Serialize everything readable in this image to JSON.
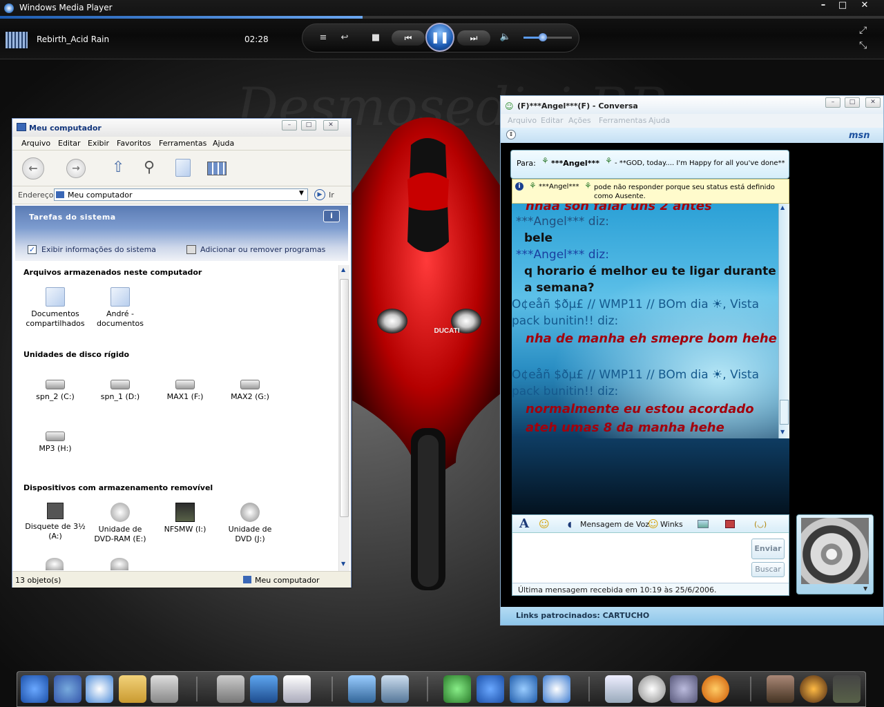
{
  "wmp": {
    "title": "Windows Media Player",
    "track": "Rebirth_Acid Rain",
    "time": "02:28",
    "progress_fraction": 0.41,
    "volume_fraction": 0.38
  },
  "wallpaper": {
    "watermark": "Desmosedici RR"
  },
  "explorer": {
    "title": "Meu computador",
    "menu": [
      "Arquivo",
      "Editar",
      "Exibir",
      "Favoritos",
      "Ferramentas",
      "Ajuda"
    ],
    "address_label": "Endereço",
    "address_value": "Meu computador",
    "go_label": "Ir",
    "tasks_header": "Tarefas do sistema",
    "task_links": [
      "Exibir informações do sistema",
      "Adicionar ou remover programas"
    ],
    "groups": [
      {
        "title": "Arquivos armazenados neste computador",
        "items": [
          "Documentos compartilhados",
          "André - documentos"
        ]
      },
      {
        "title": "Unidades de disco rígido",
        "items": [
          "spn_2 (C:)",
          "spn_1 (D:)",
          "MAX1 (F:)",
          "MAX2 (G:)",
          "MP3 (H:)"
        ]
      },
      {
        "title": "Dispositivos com armazenamento removível",
        "items": [
          "Disquete de 3½ (A:)",
          "Unidade de DVD-RAM (E:)",
          "NFSMW (I:)",
          "Unidade de DVD (J:)"
        ]
      }
    ],
    "status_count": "13 objeto(s)",
    "status_location": "Meu computador"
  },
  "msn": {
    "title": "(F)***Angel***(F) - Conversa",
    "menu": [
      "Arquivo",
      "Editar",
      "Ações",
      "Ferramentas",
      "Ajuda"
    ],
    "brand": "msn",
    "to_label": "Para:",
    "to_name": "***Angel***",
    "to_message": "- **GOD, today.... I'm Happy for all you've done**",
    "warning_name": "***Angel***",
    "warning_text": "pode não responder porque seu status está definido como Ausente.",
    "messages": [
      {
        "sender": "",
        "text": "nhaa son falar uns 2 antes"
      },
      {
        "sender": "***Angel*** diz:",
        "text": "bele"
      },
      {
        "sender": "***Angel*** diz:",
        "text": "q horario é melhor eu te ligar durante a semana?"
      },
      {
        "sender": "O¢eåñ $ðµ£ // WMP11 // BOm dia ☀, Vista pack bunitin!! diz:",
        "text": "nha de manha eh smepre bom hehe"
      },
      {
        "sender": "O¢eåñ $ðµ£ // WMP11 // BOm dia ☀, Vista pack bunitin!! diz:",
        "text": "normalmente eu estou acordado ateh umas 8 da manha hehe"
      }
    ],
    "toolbar": {
      "font": "A",
      "emoticon": "☺",
      "voice": "Mensagem de Voz",
      "winks": "Winks",
      "wink_icon": "☺",
      "nudge": "(◡)"
    },
    "send_label": "Enviar",
    "find_label": "Buscar",
    "last_message": "Última mensagem recebida em 10:19 às 25/6/2006.",
    "ads": "Links patrocinados: CARTUCHO"
  },
  "moto": {
    "brand": "DUCATI"
  }
}
